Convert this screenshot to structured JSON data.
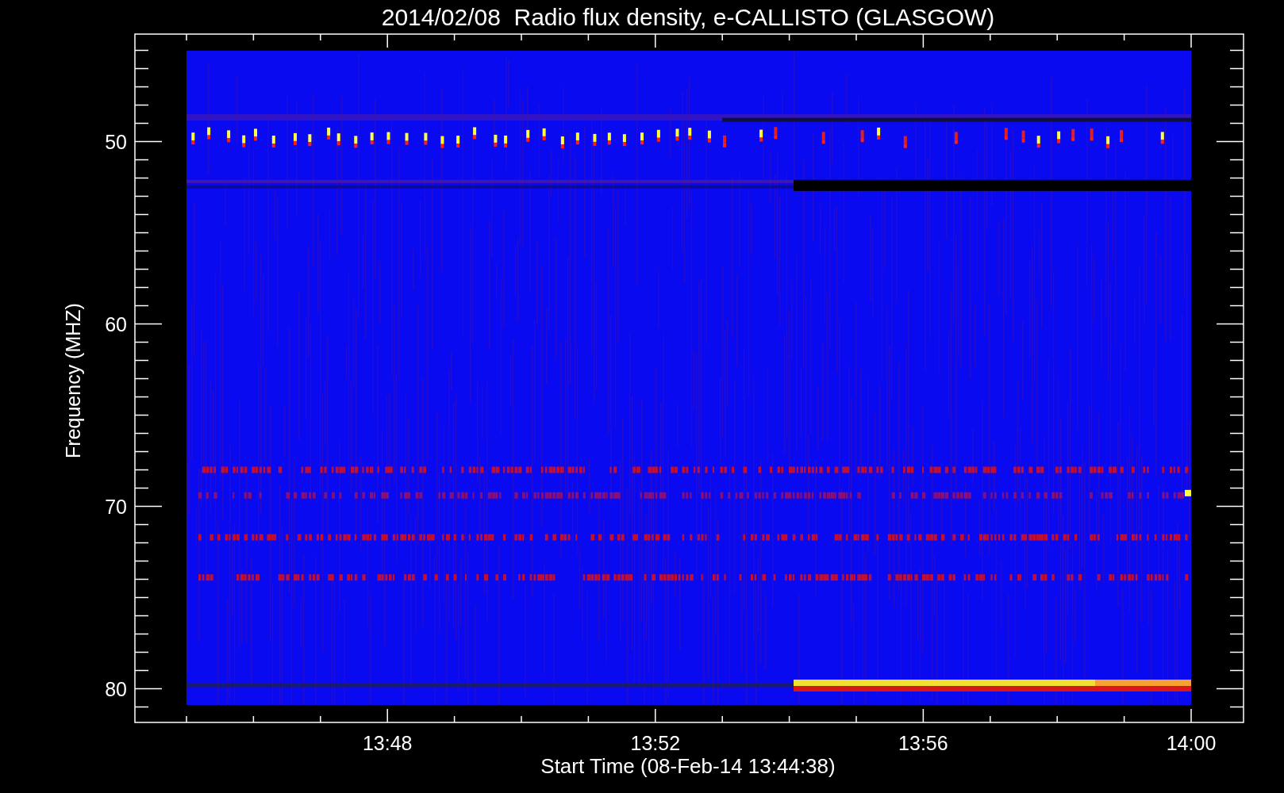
{
  "title": "2014/02/08  Radio flux density, e-CALLISTO (GLASGOW)",
  "x_axis": {
    "label": "Start Time (08-Feb-14 13:44:38)",
    "ticks": [
      "13:48",
      "13:52",
      "13:56",
      "14:00"
    ]
  },
  "y_axis": {
    "label": "Frequency (MHZ)",
    "ticks": [
      "50",
      "60",
      "70",
      "80"
    ]
  }
}
